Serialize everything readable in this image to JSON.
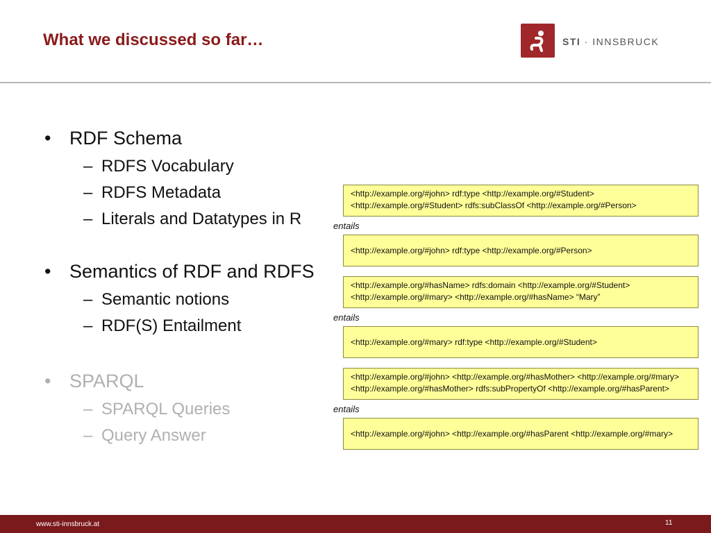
{
  "slide": {
    "title": "What we discussed so far…",
    "page_number": "11"
  },
  "logo": {
    "brand": "STI",
    "separator": "·",
    "name": "INNSBRUCK"
  },
  "bullets": [
    {
      "text": "RDF Schema",
      "sub": [
        "RDFS Vocabulary",
        "RDFS Metadata",
        "Literals and Datatypes in R"
      ]
    },
    {
      "text": "Semantics of RDF and RDFS",
      "sub": [
        "Semantic notions",
        "RDF(S) Entailment"
      ]
    },
    {
      "text": "SPARQL",
      "sub": [
        "SPARQL Queries",
        "Query Answer"
      ]
    }
  ],
  "bullet_marks": {
    "level1": "•",
    "level2": "–"
  },
  "figure": {
    "boxes": [
      {
        "lines": [
          "<http://example.org/#john> rdf:type <http://example.org/#Student>",
          "<http://example.org/#Student> rdfs:subClassOf <http://example.org/#Person>"
        ]
      },
      {
        "lines": [
          "<http://example.org/#john> rdf:type <http://example.org/#Person>"
        ]
      },
      {
        "lines": [
          "<http://example.org/#hasName> rdfs:domain <http://example.org/#Student>",
          "<http://example.org/#mary> <http://example.org/#hasName> “Mary”"
        ]
      },
      {
        "lines": [
          "<http://example.org/#mary> rdf:type <http://example.org/#Student>"
        ]
      },
      {
        "lines": [
          "<http://example.org/#john> <http://example.org/#hasMother> <http://example.org/#mary>",
          "<http://example.org/#hasMother> rdfs:subPropertyOf <http://example.org/#hasParent>"
        ]
      },
      {
        "lines": [
          "<http://example.org/#john> <http://example.org/#hasParent <http://example.org/#mary>"
        ]
      }
    ],
    "entails_label": "entails"
  },
  "footer": {
    "url": "www.sti-innsbruck.at"
  },
  "colors": {
    "title": "#8b1a1a",
    "footer": "#7a1a1d",
    "highlight_box": "#ffff99",
    "dimmed_text": "#b0b0b0"
  }
}
